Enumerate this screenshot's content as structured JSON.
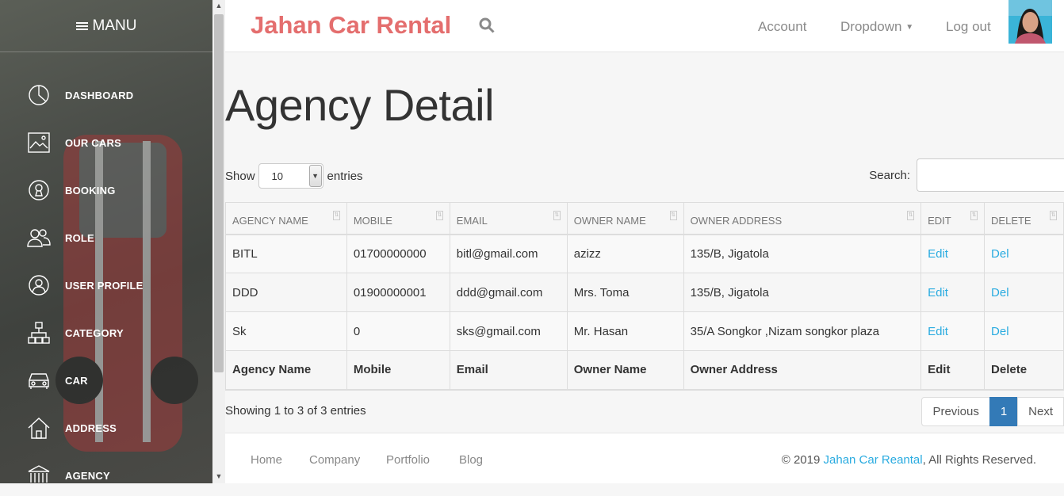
{
  "sidebar": {
    "title": "MANU",
    "items": [
      {
        "label": "DASHBOARD",
        "icon": "pie-chart-icon"
      },
      {
        "label": "OUR CARS",
        "icon": "image-icon"
      },
      {
        "label": "BOOKING",
        "icon": "keyhole-icon"
      },
      {
        "label": "ROLE",
        "icon": "users-icon"
      },
      {
        "label": "USER PROFILE",
        "icon": "user-circle-icon"
      },
      {
        "label": "CATEGORY",
        "icon": "hierarchy-icon"
      },
      {
        "label": "CAR",
        "icon": "car-icon"
      },
      {
        "label": "ADDRESS",
        "icon": "home-icon"
      },
      {
        "label": "AGENCY",
        "icon": "bank-icon"
      }
    ]
  },
  "header": {
    "brand": "Jahan Car Rental",
    "nav": {
      "account": "Account",
      "dropdown": "Dropdown",
      "logout": "Log out"
    },
    "brand_color": "#e46e6e"
  },
  "main": {
    "title": "Agency Detail",
    "length": {
      "show": "Show",
      "value": "10",
      "entries": "entries"
    },
    "search_label": "Search:",
    "columns": [
      "AGENCY NAME",
      "MOBILE",
      "EMAIL",
      "OWNER NAME",
      "OWNER ADDRESS",
      "EDIT",
      "DELETE"
    ],
    "rows": [
      {
        "agency": "BITL",
        "mobile": "01700000000",
        "email": "bitl@gmail.com",
        "owner": "azizz",
        "address": "135/B, Jigatola",
        "edit": "Edit",
        "del": "Del"
      },
      {
        "agency": "DDD",
        "mobile": "01900000001",
        "email": "ddd@gmail.com",
        "owner": "Mrs. Toma",
        "address": "135/B, Jigatola",
        "edit": "Edit",
        "del": "Del"
      },
      {
        "agency": "Sk",
        "mobile": "0",
        "email": "sks@gmail.com",
        "owner": "Mr. Hasan",
        "address": "35/A Songkor ,Nizam songkor plaza",
        "edit": "Edit",
        "del": "Del"
      }
    ],
    "footer_columns": [
      "Agency Name",
      "Mobile",
      "Email",
      "Owner Name",
      "Owner Address",
      "Edit",
      "Delete"
    ],
    "info": "Showing 1 to 3 of 3 entries",
    "pager": {
      "prev": "Previous",
      "current": "1",
      "next": "Next"
    },
    "link_color": "#29abe0",
    "active_page_color": "#337ab7"
  },
  "footer": {
    "links": [
      "Home",
      "Company",
      "Portfolio",
      "Blog"
    ],
    "copy_prefix": "© 2019 ",
    "copy_link": "Jahan Car Reantal",
    "copy_suffix": ", All Rights Reserved."
  }
}
